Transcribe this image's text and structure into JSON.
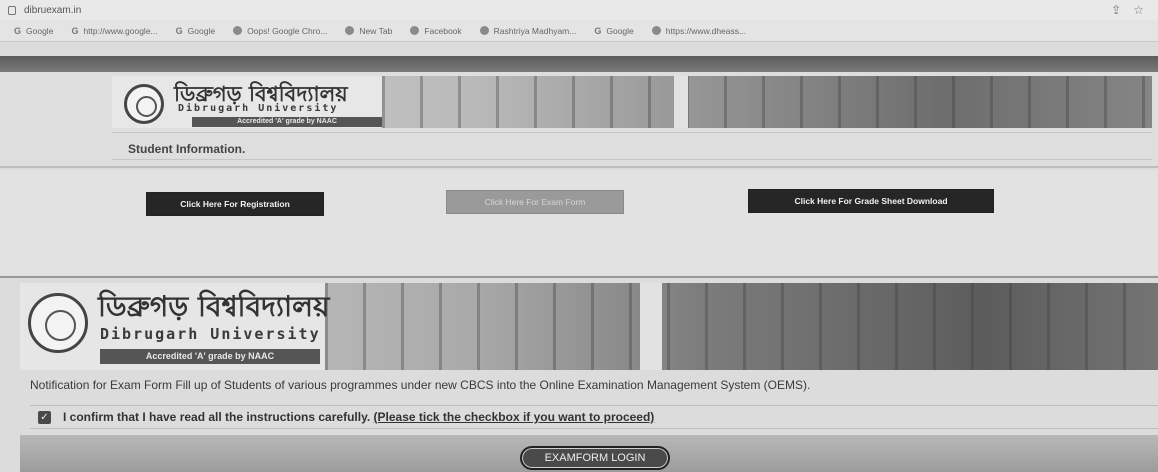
{
  "browser": {
    "url": "dibruexam.in",
    "bookmarks": [
      {
        "label": "Google",
        "icon": "google-icon"
      },
      {
        "label": "http://www.google...",
        "icon": "google-icon"
      },
      {
        "label": "Google",
        "icon": "google-icon"
      },
      {
        "label": "Oops! Google Chro...",
        "icon": "chrome-icon"
      },
      {
        "label": "New Tab",
        "icon": "chrome-icon"
      },
      {
        "label": "Facebook",
        "icon": "facebook-icon"
      },
      {
        "label": "Rashtriya Madhyam...",
        "icon": "site-icon"
      },
      {
        "label": "Google",
        "icon": "google-icon"
      },
      {
        "label": "https://www.dheass...",
        "icon": "chrome-icon"
      }
    ]
  },
  "header": {
    "title_bn": "ডিব্রুগড় বিশ্ববিদ্যালয়",
    "title_en": "Dibrugarh University",
    "accreditation": "Accredited 'A' grade by NAAC",
    "section_title": "Student Information."
  },
  "actions": {
    "registration": "Click Here For Registration",
    "exam_form": "Click Here For Exam Form",
    "grade_sheet": "Click Here For Grade Sheet Download"
  },
  "exam_section": {
    "title_bn": "ডিব্রুগড় বিশ্ববিদ্যালয়",
    "title_en": "Dibrugarh University",
    "accreditation": "Accredited 'A' grade by NAAC",
    "notification": "Notification for Exam Form Fill up of Students of various programmes under new CBCS into the Online Examination Management System (OEMS).",
    "confirm_text": "I confirm that I have read all the instructions carefully.",
    "confirm_link": "(Please tick the checkbox if you want to proceed)",
    "checkbox_checked": true,
    "login_button": "EXAMFORM LOGIN"
  }
}
